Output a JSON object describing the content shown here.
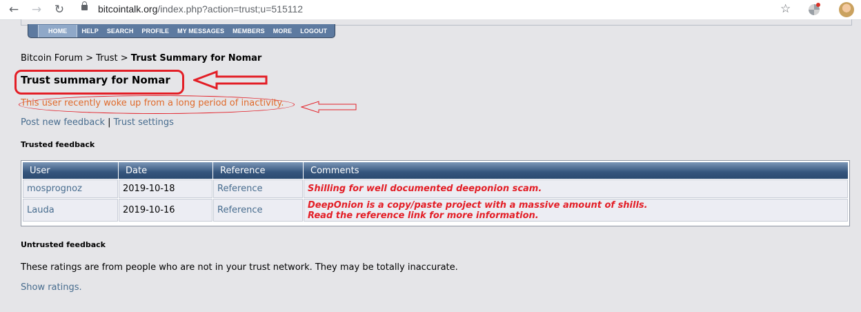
{
  "browser": {
    "url_host": "bitcointalk.org",
    "url_path": "/index.php?action=trust;u=515112"
  },
  "menu": {
    "items": [
      "HOME",
      "HELP",
      "SEARCH",
      "PROFILE",
      "MY MESSAGES",
      "MEMBERS",
      "MORE",
      "LOGOUT"
    ]
  },
  "breadcrumb": {
    "forum": "Bitcoin Forum",
    "sep1": " > ",
    "trust": "Trust",
    "sep2": " > ",
    "current": "Trust Summary for Nomar"
  },
  "page": {
    "title": "Trust summary for Nomar",
    "notice": "This user recently woke up from a long period of inactivity.",
    "post_feedback": "Post new feedback",
    "separator": "|",
    "trust_settings": "Trust settings",
    "trusted_heading": "Trusted feedback",
    "untrusted_heading": "Untrusted feedback",
    "untrusted_text": "These ratings are from people who are not in your trust network. They may be totally inaccurate.",
    "show_ratings": "Show ratings."
  },
  "table": {
    "headers": [
      "User",
      "Date",
      "Reference",
      "Comments"
    ],
    "rows": [
      {
        "user": "mosprognoz",
        "date": "2019-10-18",
        "reference": "Reference",
        "comment_line1": "Shilling for well documented deeponion scam.",
        "comment_line2": ""
      },
      {
        "user": "Lauda",
        "date": "2019-10-16",
        "reference": "Reference",
        "comment_line1": "DeepOnion is a copy/paste project with a massive amount of shills.",
        "comment_line2": "Read the reference link for more information."
      }
    ]
  },
  "colors": {
    "annotation_red": "#e31e26",
    "link_blue": "#476c8e",
    "notice_orange": "#e06a2b",
    "header_blue": "#35557d"
  }
}
